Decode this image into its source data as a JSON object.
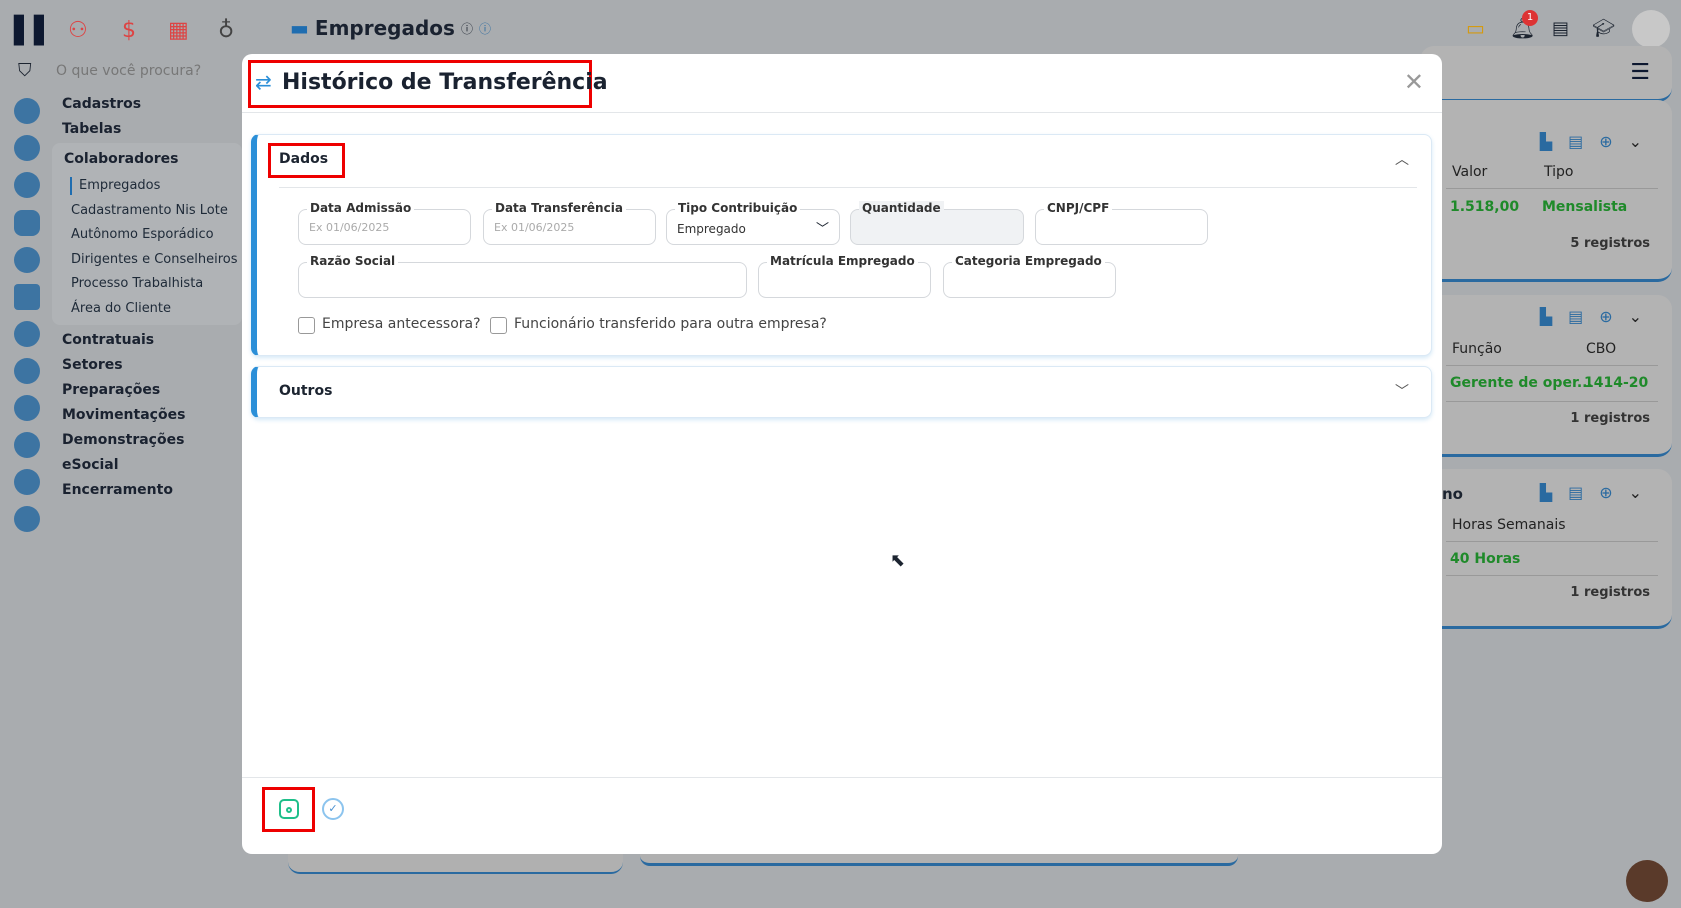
{
  "header": {
    "title": "Empregados",
    "notification_count": "1"
  },
  "search": {
    "placeholder": "O que você procura?"
  },
  "sidebar": {
    "menu": [
      "Cadastros",
      "Tabelas"
    ],
    "group": "Colaboradores",
    "sub": [
      "Empregados",
      "Cadastramento Nis Lote",
      "Autônomo Esporádico",
      "Dirigentes e Conselheiros",
      "Processo Trabalhista",
      "Área do Cliente"
    ],
    "menu2": [
      "Contratuais",
      "Setores",
      "Preparações",
      "Movimentações",
      "Demonstrações",
      "eSocial",
      "Encerramento"
    ]
  },
  "cards": [
    {
      "h1": "Valor",
      "h2": "Tipo",
      "v1": "1.518,00",
      "v2": "Mensalista",
      "count": "5 registros"
    },
    {
      "h1": "Função",
      "h2": "CBO",
      "v1": "Gerente de oper...",
      "v2": "1414-20",
      "count": "1 registros"
    },
    {
      "title": "no",
      "h1": "Horas Semanais",
      "v1": "40 Horas",
      "count": "1 registros"
    }
  ],
  "modal": {
    "title": "Histórico de Transferência",
    "section1": "Dados",
    "fields": {
      "data_admissao": {
        "label": "Data Admissão",
        "placeholder": "Ex 01/06/2025"
      },
      "data_transferencia": {
        "label": "Data Transferência",
        "placeholder": "Ex 01/06/2025"
      },
      "tipo_contribuicao": {
        "label": "Tipo Contribuição",
        "value": "Empregado"
      },
      "quantidade": {
        "label": "Quantidade"
      },
      "cnpj_cpf": {
        "label": "CNPJ/CPF"
      },
      "razao_social": {
        "label": "Razão Social"
      },
      "matricula": {
        "label": "Matrícula Empregado"
      },
      "categoria": {
        "label": "Categoria Empregado"
      }
    },
    "checkbox1": "Empresa antecessora?",
    "checkbox2": "Funcionário transferido para outra empresa?",
    "section2": "Outros"
  },
  "colors": {
    "accent": "#2b8fd8",
    "save": "#1fbf8a",
    "highlight": "#e00000"
  }
}
